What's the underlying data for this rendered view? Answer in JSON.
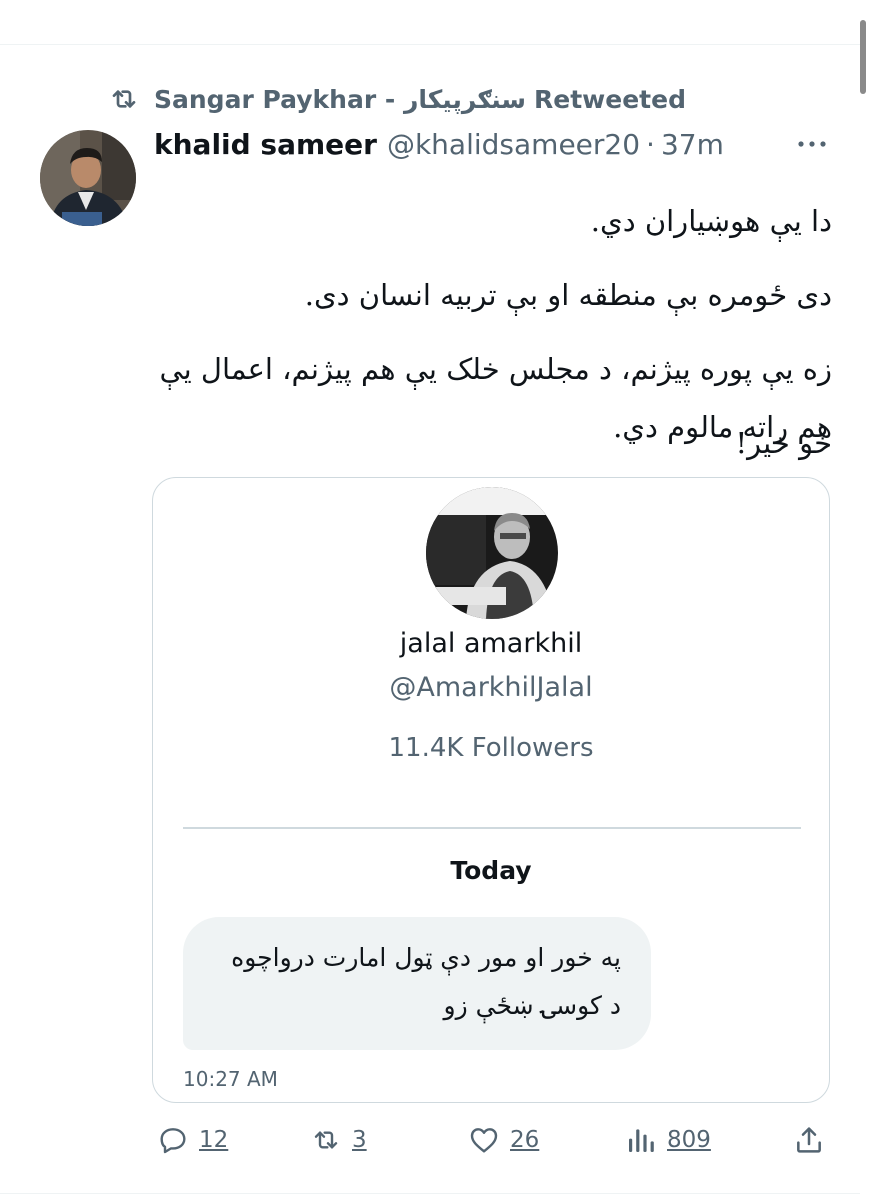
{
  "retweet": {
    "icon": "retweet-icon",
    "user": "Sangar Paykhar - سنګرپیکار",
    "suffix": "Retweeted"
  },
  "tweet": {
    "author_name": "khalid sameer",
    "author_handle": "@khalidsameer20",
    "separator": "·",
    "time": "37m",
    "more_icon": "more-horizontal-icon",
    "text_lines": [
      "دا يې هوښياران دي.",
      "دی ځومره بې منطقه او بې تربيه انسان دی.",
      "زه يې پوره پيژنم، د مجلس خلک يې هم پيژنم، اعمال يې هم راته مالوم دي.",
      "خو خير!"
    ]
  },
  "dm": {
    "name": "jalal amarkhil",
    "handle": "@AmarkhilJalal",
    "followers": "11.4K Followers",
    "day_label": "Today",
    "message_lines": [
      "په خور او مور دې ټول امارت درواچوه",
      "د کوسۍ ښځې زو"
    ],
    "time": "10:27 AM"
  },
  "actions": {
    "reply": {
      "icon": "reply-icon",
      "count": "12"
    },
    "retweet": {
      "icon": "retweet-icon",
      "count": "3"
    },
    "like": {
      "icon": "heart-icon",
      "count": "26"
    },
    "views": {
      "icon": "views-icon",
      "count": "809"
    },
    "share": {
      "icon": "share-icon"
    }
  },
  "colors": {
    "text": "#0f1419",
    "secondary": "#536471",
    "border": "#cfd9de",
    "bubble": "#eff3f4"
  }
}
